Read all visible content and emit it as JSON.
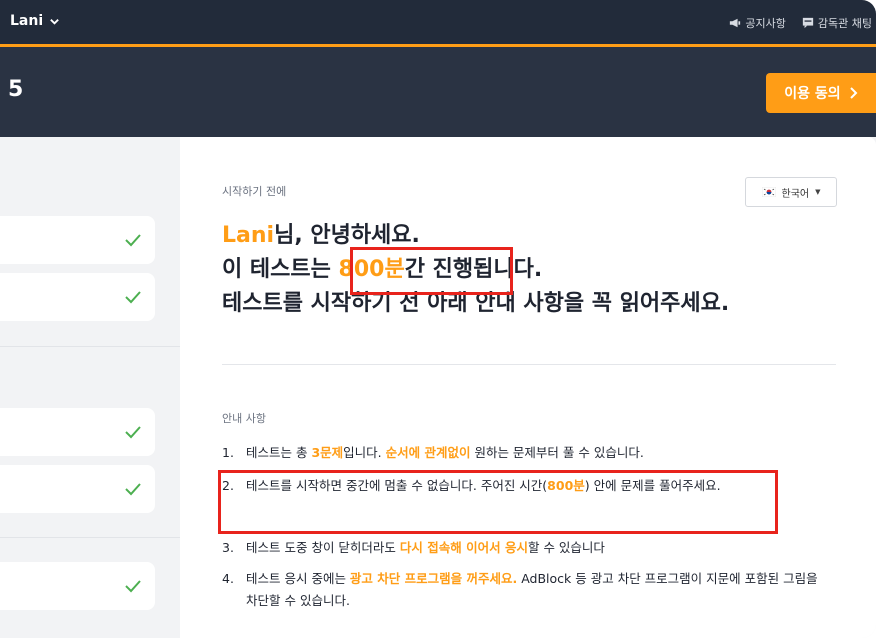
{
  "topbar": {
    "user_name": "Lani",
    "links": [
      {
        "icon": "megaphone-icon",
        "label": "공지사항"
      },
      {
        "icon": "chat-icon",
        "label": "감독관 채팅"
      }
    ]
  },
  "header": {
    "test_number_fragment": "5",
    "agree_button": "이용 동의"
  },
  "main": {
    "before_start_label": "시작하기 전에",
    "language": {
      "flag": "korea-flag-icon",
      "selected": "한국어"
    },
    "greeting": {
      "user_name": "Lani",
      "line1_suffix": "님, 안녕하세요.",
      "line2_prefix": "이 테스트는 ",
      "duration": "800분",
      "line2_mid": "간 진행",
      "line2_suffix": "됩니다.",
      "line3": "테스트를 시작하기 전 아래 안내 사항을 꼭 읽어주세요."
    },
    "notice_label": "안내 사항",
    "notices": [
      {
        "num": "1.",
        "parts": [
          {
            "text": "테스트는 총 ",
            "em": false
          },
          {
            "text": "3문제",
            "em": true
          },
          {
            "text": "입니다. ",
            "em": false
          },
          {
            "text": "순서에 관계없이",
            "em": true
          },
          {
            "text": " 원하는 문제부터 풀 수 있습니다.",
            "em": false
          }
        ]
      },
      {
        "num": "2.",
        "parts": [
          {
            "text": "테스트를 시작하면 중간에 멈출 수 없습니다. 주어진 시간(",
            "em": false
          },
          {
            "text": "800분",
            "em": true
          },
          {
            "text": ") 안에 문제를 풀어주세요.",
            "em": false
          }
        ]
      },
      {
        "num": "3.",
        "parts": [
          {
            "text": "테스트 도중 창이 닫히더라도 ",
            "em": false
          },
          {
            "text": "다시 접속해 이어서 응시",
            "em": true
          },
          {
            "text": "할 수 있습니다",
            "em": false
          }
        ]
      },
      {
        "num": "4.",
        "parts": [
          {
            "text": "테스트 응시 중에는 ",
            "em": false
          },
          {
            "text": "광고 차단 프로그램을 꺼주세요.",
            "em": true
          },
          {
            "text": " AdBlock 등 광고 차단 프로그램이 지문에 포함된 그림을 차단할 수 있습니다.",
            "em": false
          }
        ]
      }
    ]
  },
  "colors": {
    "accent": "#ff9d16",
    "navy": "#222b3a",
    "highlight": "#e8231c"
  }
}
